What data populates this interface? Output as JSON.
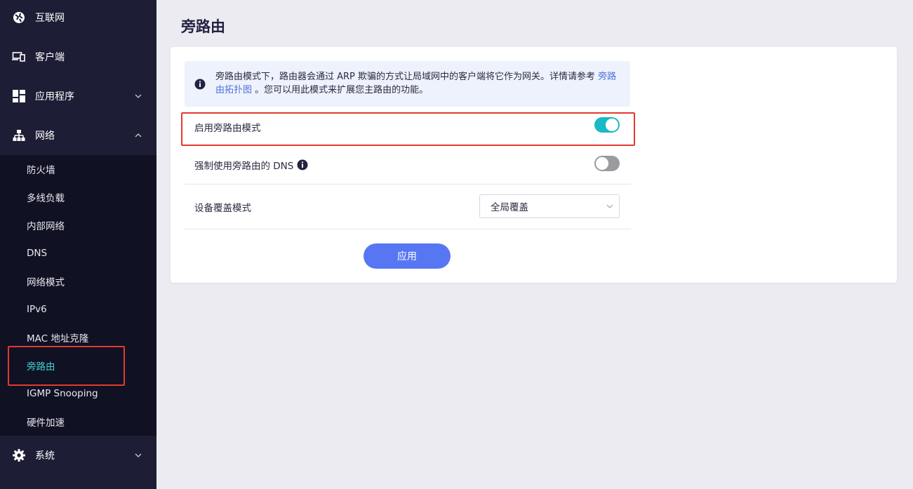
{
  "sidebar": {
    "top_items": [
      {
        "label": "互联网",
        "icon": "globe-icon"
      },
      {
        "label": "客户端",
        "icon": "devices-icon"
      },
      {
        "label": "应用程序",
        "icon": "apps-grid-icon",
        "chevron": "down"
      },
      {
        "label": "网络",
        "icon": "network-icon",
        "chevron": "up"
      }
    ],
    "network_submenu": [
      {
        "label": "防火墙"
      },
      {
        "label": "多线负载"
      },
      {
        "label": "内部网络"
      },
      {
        "label": "DNS"
      },
      {
        "label": "网络模式"
      },
      {
        "label": "IPv6"
      },
      {
        "label": "MAC 地址克隆"
      },
      {
        "label": "旁路由",
        "active": true
      },
      {
        "label": "IGMP Snooping"
      },
      {
        "label": "硬件加速"
      }
    ],
    "bottom_items": [
      {
        "label": "系统",
        "icon": "gear-icon",
        "chevron": "down"
      }
    ]
  },
  "page": {
    "title": "旁路由"
  },
  "info": {
    "text_before": "旁路由模式下，路由器会通过 ARP 欺骗的方式让局域网中的客户端将它作为网关。详情请参考 ",
    "link": "旁路由拓扑图",
    "text_after": " 。您可以用此模式来扩展您主路由的功能。"
  },
  "settings": {
    "enable_bypass": {
      "label": "启用旁路由模式",
      "enabled": true
    },
    "force_dns": {
      "label": "强制使用旁路由的 DNS",
      "enabled": false
    },
    "coverage": {
      "label": "设备覆盖模式",
      "selected": "全局覆盖"
    }
  },
  "actions": {
    "apply_label": "应用"
  },
  "colors": {
    "sidebar_bg": "#1d1d35",
    "submenu_bg": "#111124",
    "active_text": "#3fd3c9",
    "toggle_on": "#19b9c6",
    "primary_button": "#5777f2",
    "highlight_border": "#e23a2e"
  }
}
